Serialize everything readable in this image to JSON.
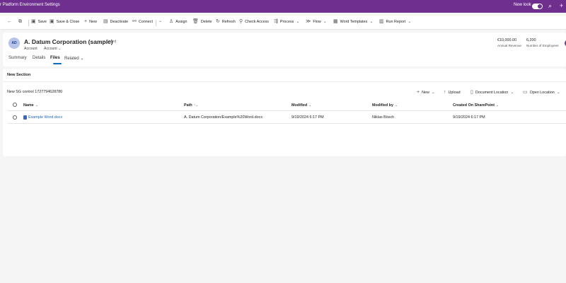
{
  "topbar": {
    "title": "r Platform Environment Settings",
    "new_look_label": "New look",
    "new_look_enabled": true,
    "icons": [
      "search-icon",
      "add-icon"
    ]
  },
  "command_bar": {
    "back_icon": "back-arrow-icon",
    "popout_icon": "open-in-new-window-icon",
    "save": "Save",
    "save_close": "Save & Close",
    "new": "New",
    "deactivate": "Deactivate",
    "connect": "Connect",
    "assign": "Assign",
    "delete": "Delete",
    "refresh": "Refresh",
    "check_access": "Check Access",
    "process": "Process",
    "flow": "Flow",
    "word_templates": "Word Templates",
    "run_report": "Run Report"
  },
  "record": {
    "avatar_initials": "AD",
    "name": "A. Datum Corporation (sample)",
    "saved_status": "- Saved",
    "entity": "Account",
    "form": "Account",
    "annual_revenue_value": "€10,000.00",
    "annual_revenue_label": "Annual Revenue",
    "employees_value": "6,200",
    "employees_label": "Number of Employees"
  },
  "tabs": {
    "summary": "Summary",
    "details": "Details",
    "files": "Files",
    "related": "Related",
    "active": "Files"
  },
  "section": {
    "title": "New Section",
    "grid_title": "New SG control 1727794628780",
    "grid_commands": {
      "new": "New",
      "upload": "Upload",
      "document_location": "Document Location",
      "open_location": "Open Location"
    }
  },
  "table": {
    "columns": [
      {
        "label": "Name",
        "sort": "⌄"
      },
      {
        "label": "Path",
        "sort": "↑⌄"
      },
      {
        "label": "Modified",
        "sort": "⌄"
      },
      {
        "label": "Modified by",
        "sort": "⌄"
      },
      {
        "label": "Created On SharePoint",
        "sort": "⌄"
      }
    ],
    "rows": [
      {
        "name": "Example Word.docx",
        "path": "A. Datum Corporation/Example%20Word.docx",
        "modified": "9/19/2024 6:17 PM",
        "modified_by": "Niklas Bösch",
        "created_on_sharepoint": "9/19/2024 6:17 PM"
      }
    ]
  },
  "colors": {
    "brand": "#6f2f8f",
    "link": "#2266c4",
    "tab_underline": "#0f6cbd"
  }
}
